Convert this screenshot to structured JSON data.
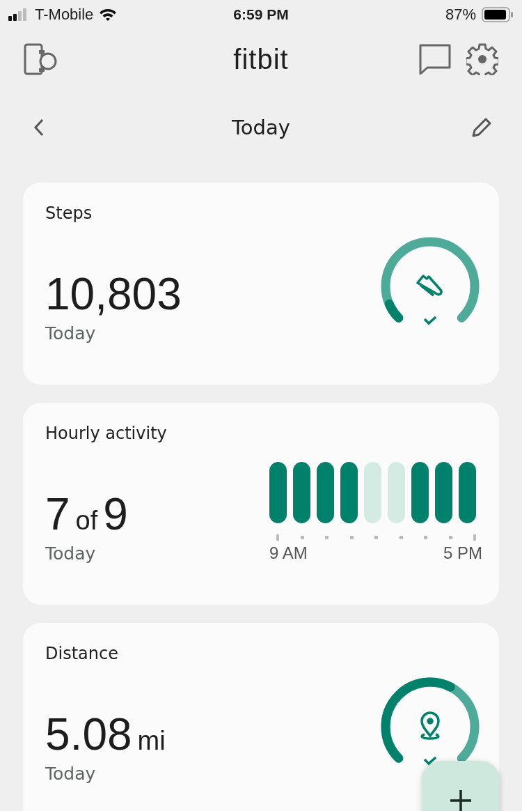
{
  "status_bar": {
    "carrier": "T-Mobile",
    "time": "6:59 PM",
    "battery": "87%"
  },
  "header": {
    "title": "fitbit"
  },
  "date_nav": {
    "title": "Today"
  },
  "cards": [
    {
      "kind": "ring",
      "title": "Steps",
      "value": "10,803",
      "period": "Today",
      "goal_met": true
    },
    {
      "kind": "hourly",
      "title": "Hourly activity",
      "value": "7",
      "joiner": "of",
      "total": "9",
      "period": "Today",
      "hours": [
        {
          "met": true
        },
        {
          "met": true
        },
        {
          "met": true
        },
        {
          "met": true
        },
        {
          "met": false
        },
        {
          "met": false
        },
        {
          "met": true
        },
        {
          "met": true
        },
        {
          "met": true
        }
      ],
      "start_label": "9 AM",
      "end_label": "5 PM"
    },
    {
      "kind": "ring",
      "title": "Distance",
      "value": "5.08",
      "unit": "mi",
      "period": "Today",
      "goal_met": true
    }
  ]
}
